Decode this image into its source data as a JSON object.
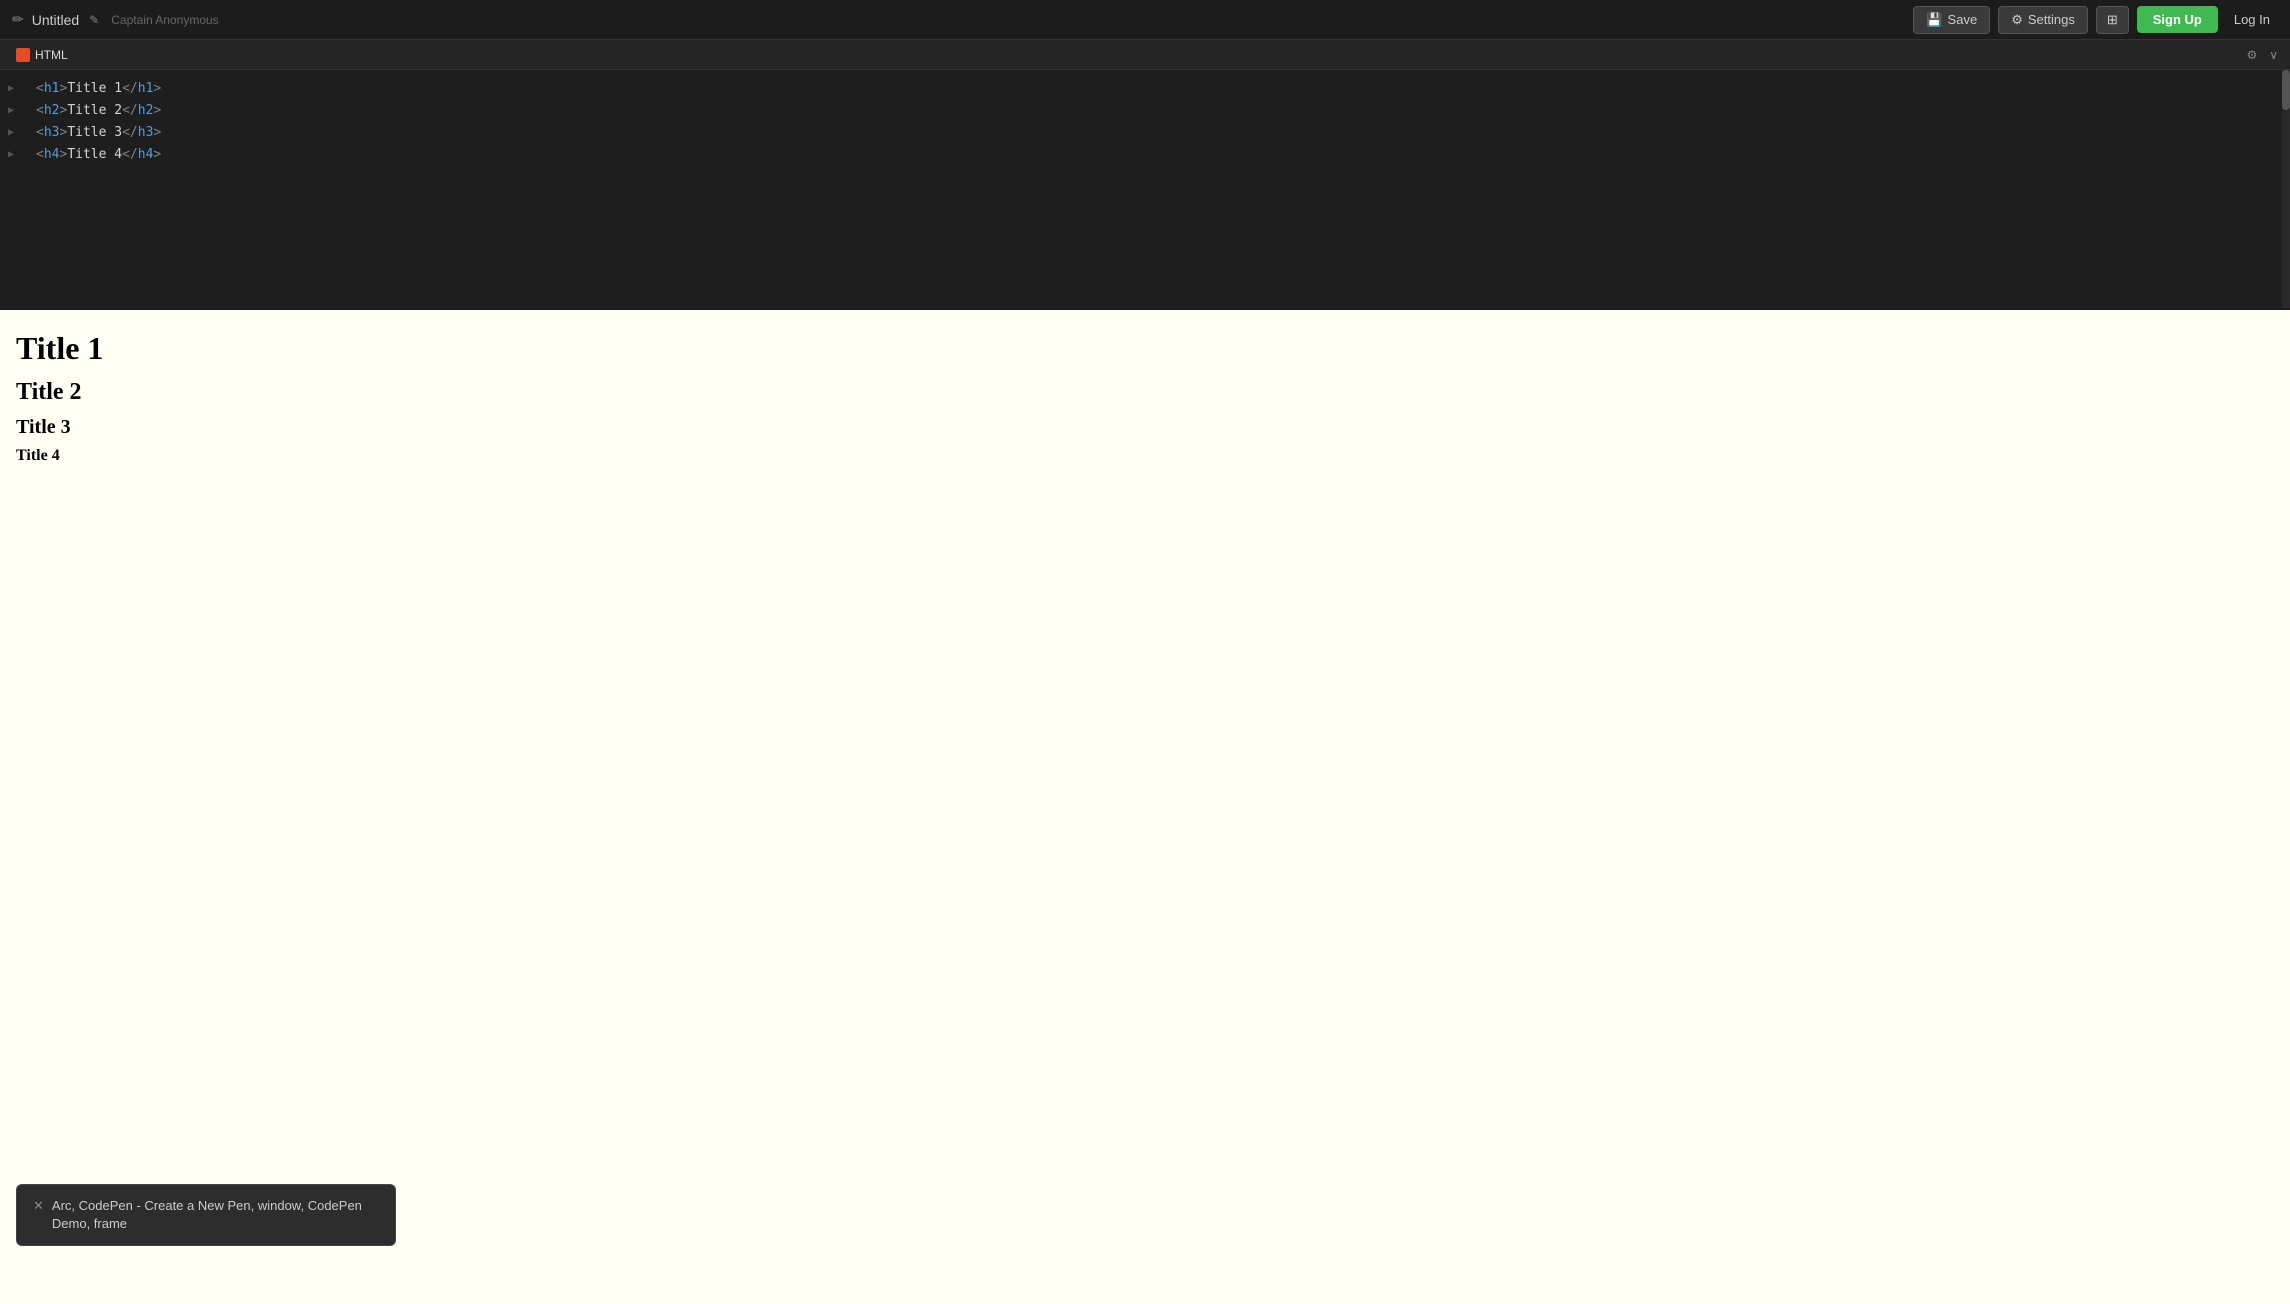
{
  "app": {
    "title": "Untitled",
    "edit_icon": "✎",
    "subtitle": "Captain Anonymous"
  },
  "navbar": {
    "save_label": "Save",
    "settings_label": "Settings",
    "signup_label": "Sign Up",
    "login_label": "Log In",
    "save_icon": "💾",
    "settings_icon": "⚙",
    "grid_icon": "⊞"
  },
  "editor": {
    "tab_label": "HTML",
    "lines": [
      {
        "id": 1,
        "code": "<h1>Title 1</h1>"
      },
      {
        "id": 2,
        "code": "<h2>Title 2</h2>"
      },
      {
        "id": 3,
        "code": "<h3>Title 3</h3>"
      },
      {
        "id": 4,
        "code": "<h4>Title 4</h4>"
      }
    ]
  },
  "preview": {
    "h1": "Title 1",
    "h2": "Title 2",
    "h3": "Title 3",
    "h4": "Title 4"
  },
  "tooltip": {
    "close_icon": "✕",
    "text": "Arc, CodePen - Create a New Pen, window, CodePen Demo, frame"
  }
}
